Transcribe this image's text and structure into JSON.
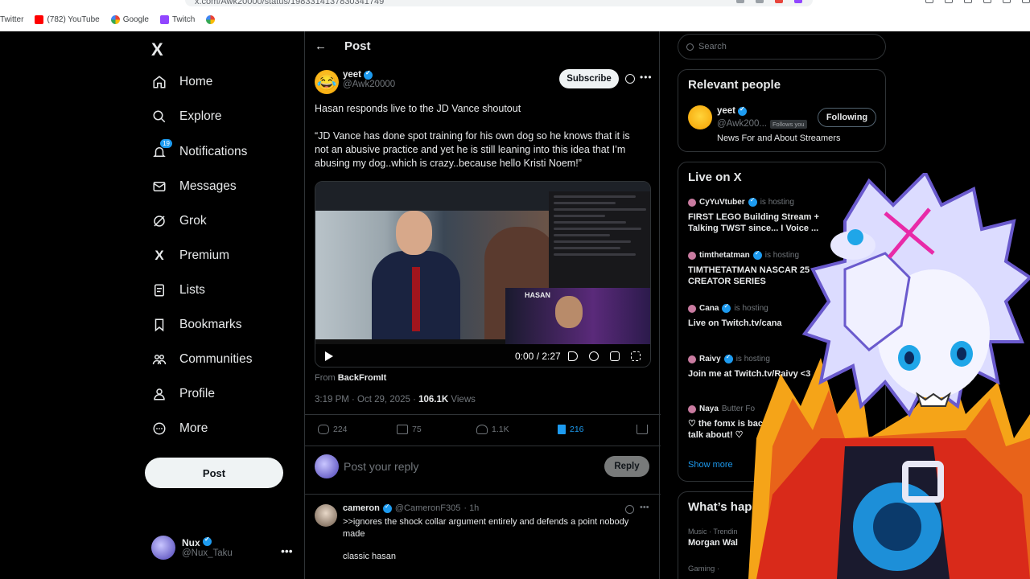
{
  "browser": {
    "url": "x.com/Awk20000/status/1983314137830341749",
    "bookmarks": [
      {
        "label": "Twitter"
      },
      {
        "label": "(782) YouTube"
      },
      {
        "label": "Google"
      },
      {
        "label": "Twitch"
      }
    ]
  },
  "nav": {
    "logo": "X",
    "items": [
      {
        "label": "Home",
        "icon": "home-icon"
      },
      {
        "label": "Explore",
        "icon": "search-icon"
      },
      {
        "label": "Notifications",
        "icon": "bell-icon",
        "badge": "19"
      },
      {
        "label": "Messages",
        "icon": "envelope-icon"
      },
      {
        "label": "Grok",
        "icon": "grok-icon"
      },
      {
        "label": "Premium",
        "icon": "x-icon"
      },
      {
        "label": "Lists",
        "icon": "list-icon"
      },
      {
        "label": "Bookmarks",
        "icon": "bookmark-icon"
      },
      {
        "label": "Communities",
        "icon": "people-icon"
      },
      {
        "label": "Profile",
        "icon": "person-icon"
      },
      {
        "label": "More",
        "icon": "more-circle-icon"
      }
    ],
    "post_label": "Post",
    "me": {
      "name": "Nux",
      "handle": "@Nux_Taku"
    }
  },
  "post": {
    "header": "Post",
    "author": {
      "name": "yeet",
      "handle": "@Awk20000"
    },
    "subscribe_label": "Subscribe",
    "text": "Hasan responds live to the JD Vance shoutout\n\n“JD Vance has done spot training for his own dog so he knows that it is not an abusive practice and yet he is still leaning into this idea that I’m abusing my dog..which is crazy..because hello Kristi Noem!”",
    "video": {
      "time": "0:00 / 2:27",
      "cam_label": "HASAN"
    },
    "from_prefix": "From",
    "from_source": "BackFromIt",
    "timestamp": "3:19 PM · Oct 29, 2025 · ",
    "views_count": "106.1K",
    "views_label": " Views",
    "stats": {
      "replies": "224",
      "reposts": "75",
      "likes": "1.1K",
      "bookmarks": "216"
    },
    "reply_placeholder": "Post your reply",
    "reply_label": "Reply",
    "accent": "#1d9bf0"
  },
  "comment": {
    "name": "cameron",
    "handle": "@CameronF305",
    "time": "· 1h",
    "text": ">>ignores the shock collar argument entirely and defends a point nobody made",
    "text2": "classic hasan"
  },
  "right": {
    "search_placeholder": "Search",
    "relevant": {
      "title": "Relevant people",
      "name": "yeet",
      "handle": "@Awk200...",
      "follows_you": "Follows you",
      "following_label": "Following",
      "bio": "News For and About Streamers"
    },
    "live": {
      "title": "Live on X",
      "items": [
        {
          "host": "CyYuVtuber",
          "status": "is hosting",
          "title": "FIRST LEGO Building Stream + Talking TWST since... I Voice ..."
        },
        {
          "host": "timthetatman",
          "status": "is hosting",
          "title": "TIMTHETATMAN NASCAR 25 CREATOR SERIES"
        },
        {
          "host": "Cana",
          "status": "is hosting",
          "title": "Live on Twitch.tv/cana"
        },
        {
          "host": "Raivy",
          "status": "is hosting",
          "title": "Join me at Twitch.tv/Raivy <3"
        },
        {
          "host": "Naya",
          "status": "Butter Fo",
          "title": "♡ the fomx is bacc! and A LOT to talk about! ♡"
        }
      ],
      "show_more": "Show more"
    },
    "whats_happening": {
      "title": "What’s hap",
      "sub": "Music · Trendin",
      "topic": "Morgan Wal",
      "sub2": "Gaming ·"
    }
  }
}
